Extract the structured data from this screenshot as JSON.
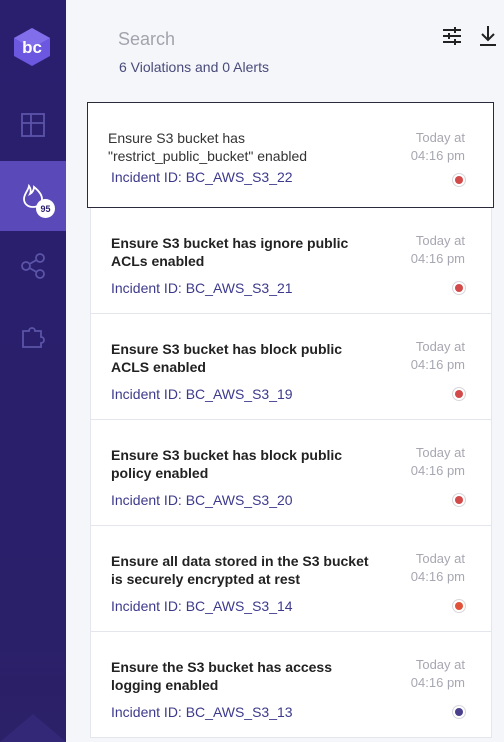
{
  "sidebar": {
    "logo_text": "bc",
    "items": [
      {
        "name": "dashboard",
        "icon": "grid-icon"
      },
      {
        "name": "violations",
        "icon": "flame-icon",
        "badge": "95",
        "active": true
      },
      {
        "name": "integrations",
        "icon": "share-icon"
      },
      {
        "name": "plugins",
        "icon": "puzzle-icon"
      }
    ]
  },
  "header": {
    "search_placeholder": "Search",
    "summary": "6 Violations and 0 Alerts",
    "filter_icon": "sliders-icon",
    "download_icon": "download-icon"
  },
  "violations": [
    {
      "title": "Ensure S3 bucket has \"restrict_public_bucket\" enabled",
      "incident": "Incident ID: BC_AWS_S3_22",
      "time_line1": "Today at",
      "time_line2": "04:16 pm",
      "status_color": "#d24a4a",
      "selected": true
    },
    {
      "title": "Ensure S3 bucket has ignore public ACLs enabled",
      "incident": "Incident ID: BC_AWS_S3_21",
      "time_line1": "Today at",
      "time_line2": "04:16 pm",
      "status_color": "#d24a4a"
    },
    {
      "title": "Ensure S3 bucket has block public ACLS enabled",
      "incident": "Incident ID: BC_AWS_S3_19",
      "time_line1": "Today at",
      "time_line2": "04:16 pm",
      "status_color": "#d24a4a"
    },
    {
      "title": "Ensure S3 bucket has block public policy enabled",
      "incident": "Incident ID: BC_AWS_S3_20",
      "time_line1": "Today at",
      "time_line2": "04:16 pm",
      "status_color": "#d24a4a"
    },
    {
      "title": "Ensure all data stored in the S3 bucket is securely encrypted at rest",
      "incident": "Incident ID: BC_AWS_S3_14",
      "time_line1": "Today at",
      "time_line2": "04:16 pm",
      "status_color": "#e0533a"
    },
    {
      "title": "Ensure the S3 bucket has access logging enabled",
      "incident": "Incident ID: BC_AWS_S3_13",
      "time_line1": "Today at",
      "time_line2": "04:16 pm",
      "status_color": "#4a3f8c"
    }
  ]
}
